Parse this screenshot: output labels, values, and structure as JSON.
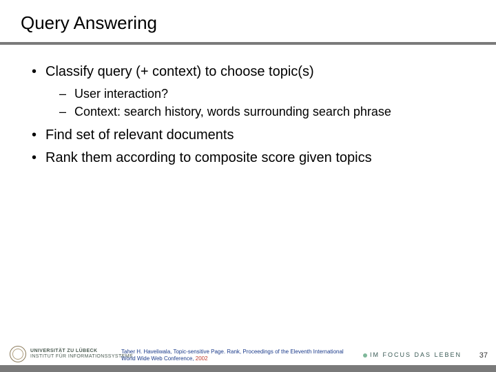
{
  "title": "Query Answering",
  "bullets": [
    {
      "level": 1,
      "text": "Classify query (+ context) to choose topic(s)"
    },
    {
      "level": 2,
      "text": "User interaction?"
    },
    {
      "level": 2,
      "text": "Context: search history, words surrounding search phrase"
    },
    {
      "level": 1,
      "text": "Find set of relevant documents"
    },
    {
      "level": 1,
      "text": "Rank them according to composite score given topics"
    }
  ],
  "footer": {
    "university_line1": "UNIVERSITÄT ZU LÜBECK",
    "university_line2": "INSTITUT FÜR INFORMATIONSSYSTEME",
    "citation_main": "Taher H. Haveliwala, Topic-sensitive Page. Rank, Proceedings of the Eleventh International World Wide Web Conference, ",
    "citation_year": "2002",
    "motto": "IM FOCUS DAS LEBEN",
    "page": "37"
  }
}
